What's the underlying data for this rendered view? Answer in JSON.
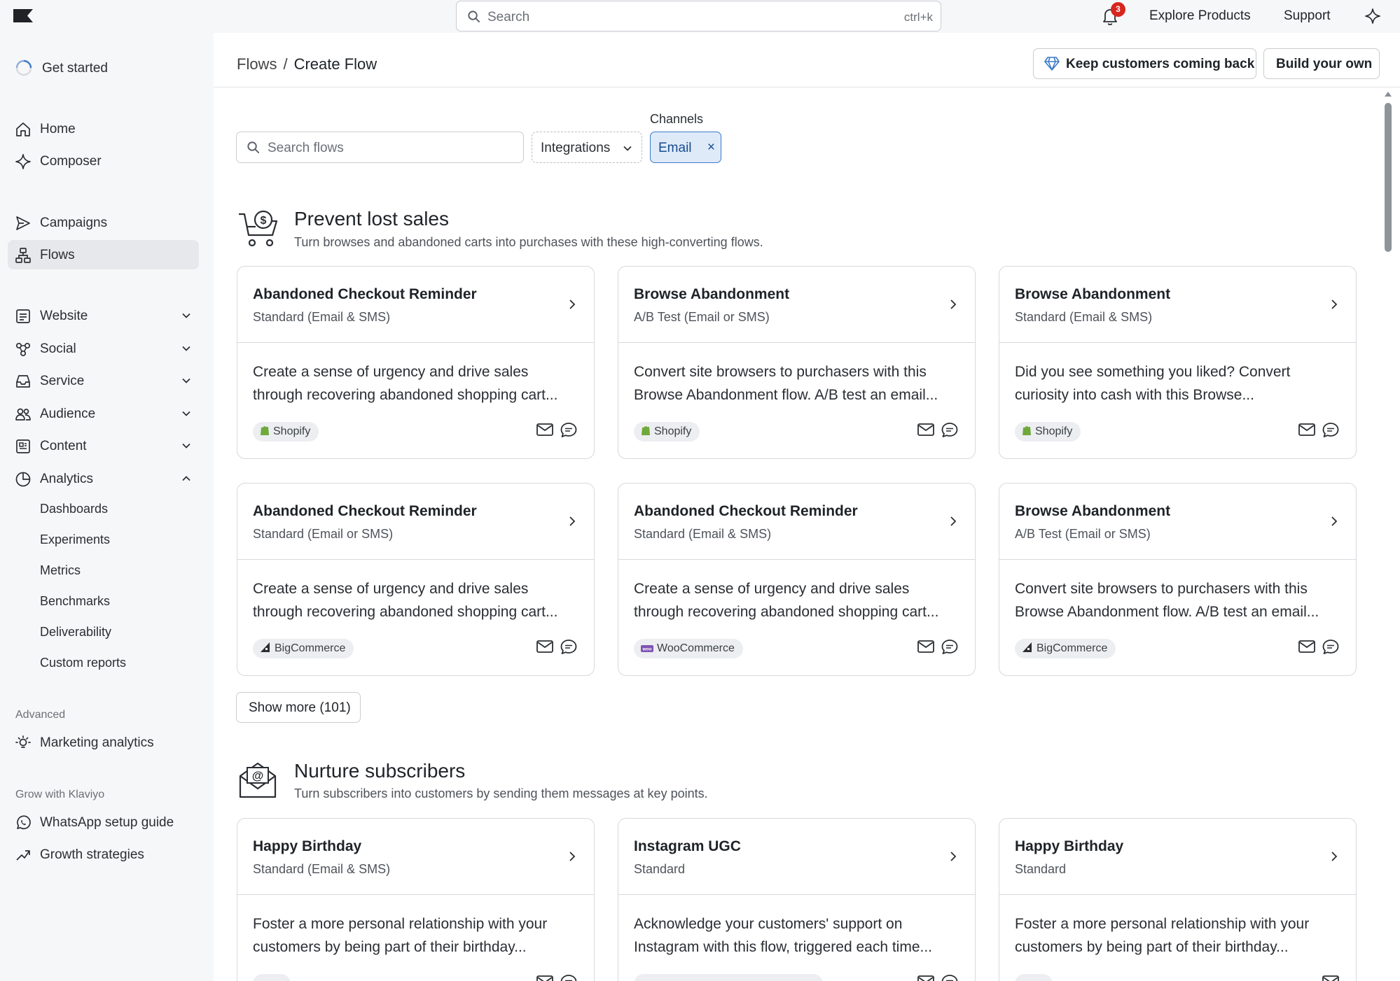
{
  "topbar": {
    "search_placeholder": "Search",
    "search_shortcut": "ctrl+k",
    "notification_count": "3",
    "explore": "Explore Products",
    "support": "Support"
  },
  "sidebar": {
    "get_started": "Get started",
    "items": [
      {
        "label": "Home",
        "icon": "home-icon"
      },
      {
        "label": "Composer",
        "icon": "sparkle-icon"
      },
      {
        "label": "Campaigns",
        "icon": "send-icon"
      },
      {
        "label": "Flows",
        "icon": "flows-icon",
        "active": true
      },
      {
        "label": "Website",
        "icon": "website-icon"
      },
      {
        "label": "Social",
        "icon": "social-icon"
      },
      {
        "label": "Service",
        "icon": "inbox-icon"
      },
      {
        "label": "Audience",
        "icon": "audience-icon"
      },
      {
        "label": "Content",
        "icon": "content-icon"
      },
      {
        "label": "Analytics",
        "icon": "analytics-icon",
        "expanded": true
      }
    ],
    "analytics_sub": [
      "Dashboards",
      "Experiments",
      "Metrics",
      "Benchmarks",
      "Deliverability",
      "Custom reports"
    ],
    "advanced_label": "Advanced",
    "marketing_analytics": "Marketing analytics",
    "grow_label": "Grow with Klaviyo",
    "whatsapp": "WhatsApp setup guide",
    "growth": "Growth strategies"
  },
  "header": {
    "crumb_root": "Flows",
    "crumb_sep": "/",
    "crumb_current": "Create Flow",
    "keep_btn": "Keep customers coming back",
    "build_btn": "Build your own"
  },
  "filters": {
    "search_placeholder": "Search flows",
    "integrations": "Integrations",
    "channels_label": "Channels",
    "chip": "Email",
    "chip_close": "×"
  },
  "sections": [
    {
      "title": "Prevent lost sales",
      "subtitle": "Turn browses and abandoned carts into purchases with these high-converting flows.",
      "cards": [
        {
          "title": "Abandoned Checkout Reminder",
          "subtitle": "Standard (Email & SMS)",
          "desc1": "Create a sense of urgency and drive sales",
          "desc2": "through recovering abandoned shopping cart...",
          "tag": "Shopify",
          "tag_icon": "shopify"
        },
        {
          "title": "Browse Abandonment",
          "subtitle": "A/B Test (Email or SMS)",
          "desc1": "Convert site browsers to purchasers with this",
          "desc2": "Browse Abandonment flow. A/B test an email...",
          "tag": "Shopify",
          "tag_icon": "shopify"
        },
        {
          "title": "Browse Abandonment",
          "subtitle": "Standard (Email & SMS)",
          "desc1": "Did you see something you liked? Convert",
          "desc2": "curiosity into cash with this Browse...",
          "tag": "Shopify",
          "tag_icon": "shopify"
        },
        {
          "title": "Abandoned Checkout Reminder",
          "subtitle": "Standard (Email or SMS)",
          "desc1": "Create a sense of urgency and drive sales",
          "desc2": "through recovering abandoned shopping cart...",
          "tag": "BigCommerce",
          "tag_icon": "bigcommerce"
        },
        {
          "title": "Abandoned Checkout Reminder",
          "subtitle": "Standard (Email & SMS)",
          "desc1": "Create a sense of urgency and drive sales",
          "desc2": "through recovering abandoned shopping cart...",
          "tag": "WooCommerce",
          "tag_icon": "woocommerce"
        },
        {
          "title": "Browse Abandonment",
          "subtitle": "A/B Test (Email or SMS)",
          "desc1": "Convert site browsers to purchasers with this",
          "desc2": "Browse Abandonment flow. A/B test an email...",
          "tag": "BigCommerce",
          "tag_icon": "bigcommerce"
        }
      ]
    },
    {
      "title": "Nurture subscribers",
      "subtitle": "Turn subscribers into customers by sending them messages at key points.",
      "cards": [
        {
          "title": "Happy Birthday",
          "subtitle": "Standard (Email & SMS)",
          "desc1": "Foster a more personal relationship with your",
          "desc2": "customers by being part of their birthday..."
        },
        {
          "title": "Instagram UGC",
          "subtitle": "Standard",
          "desc1": "Acknowledge your customers' support on",
          "desc2": "Instagram with this flow, triggered each time..."
        },
        {
          "title": "Happy Birthday",
          "subtitle": "Standard",
          "desc1": "Foster a more personal relationship with your",
          "desc2": "customers by being part of their birthday..."
        }
      ]
    }
  ],
  "show_more": "Show more (101)",
  "colors": {
    "accent": "#3c79c9",
    "badge": "#d7261e",
    "shopify": "#6fa83b",
    "woo": "#7f54b3"
  }
}
